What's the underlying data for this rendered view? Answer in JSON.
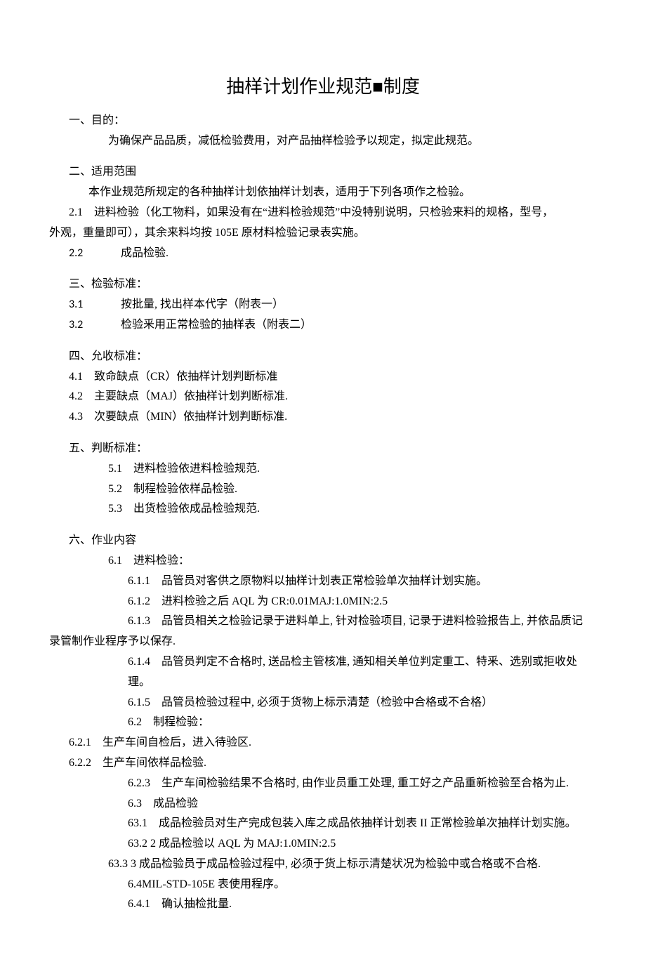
{
  "title_a": "抽样计划作业规范",
  "title_b": "制度",
  "s1": {
    "head": "一、目的：",
    "body": "为确保产品品质，减低检验费用，对产品抽样检验予以规定，拟定此规范。"
  },
  "s2": {
    "head": "二、适用范围",
    "body": "本作业规范所规定的各种抽样计划依抽样计划表，适用于下列各项作之检验。",
    "p2_1a": "2.1　进料检验（化工物料，如果没有在“进料检验规范”中没特别说明，只检验来料的规格，型号，",
    "p2_1b": "外观，重量即可），其余来料均按 105E 原材料检验记录表实施。",
    "p2_2_num": "2.2",
    "p2_2_txt": "成品检验."
  },
  "s3": {
    "head": "三、检验标准：",
    "p3_1_num": "3.1",
    "p3_1_txt": "按批量, 找出样本代字（附表一）",
    "p3_2_num": "3.2",
    "p3_2_txt": "检验釆用正常检验的抽样表（附表二）"
  },
  "s4": {
    "head": "四、允收标准：",
    "p4_1": "4.1　致命缺点（CR）依抽样计划判断标准",
    "p4_2": "4.2　主要缺点（MAJ）依抽样计划判断标准.",
    "p4_3": "4.3　次要缺点（MIN）依抽样计划判断标准."
  },
  "s5": {
    "head": "五、判断标准：",
    "p5_1": "5.1　进料检验依进料检验规范.",
    "p5_2": "5.2　制程检验依样品检验.",
    "p5_3": "5.3　出货检验依成品检验规范."
  },
  "s6": {
    "head": "六、作业内容",
    "p6_1": "6.1　进料检验：",
    "p6_1_1": "6.1.1　品管员对客供之原物料以抽样计划表正常检验单次抽样计划实施。",
    "p6_1_2": "6.1.2　进料检验之后 AQL 为 CR:0.01MAJ:1.0MIN:2.5",
    "p6_1_3a": "6.1.3　品管员相关之检验记录于进料单上, 针对检验项目, 记录于进料检验报告上, 并依品质记",
    "p6_1_3b": "录管制作业程序予以保存.",
    "p6_1_4": "6.1.4　品管员判定不合格时, 送品检主管核准, 通知相关单位判定重工、特釆、选别或拒收处理。",
    "p6_1_5": "6.1.5　品管员检验过程中, 必须于货物上标示清楚（检验中合格或不合格）",
    "p6_2": "6.2　制程检验：",
    "p6_2_1": "6.2.1　生产车间自检后，进入待验区.",
    "p6_2_2": "6.2.2　生产车间依样品检验.",
    "p6_2_3": "6.2.3　生产车间检验结果不合格时, 由作业员重工处理, 重工好之产品重新检验至合格为止.",
    "p6_3": "6.3　成品检验",
    "p6_3_1": "63.1　成品检验员对生产完成包装入库之成品依抽样计划表 II 正常检验单次抽样计划实施。",
    "p6_3_2": "63.2  2 成品检验以 AQL 为 MAJ:1.0MIN:2.5",
    "p6_3_3": "63.3  3 成品检验员于成品检验过程中, 必须于货上标示清楚状况为检验中或合格或不合格.",
    "p6_4": "6.4MIL-STD-105E 表使用程序。",
    "p6_4_1": "6.4.1　确认抽检批量."
  }
}
